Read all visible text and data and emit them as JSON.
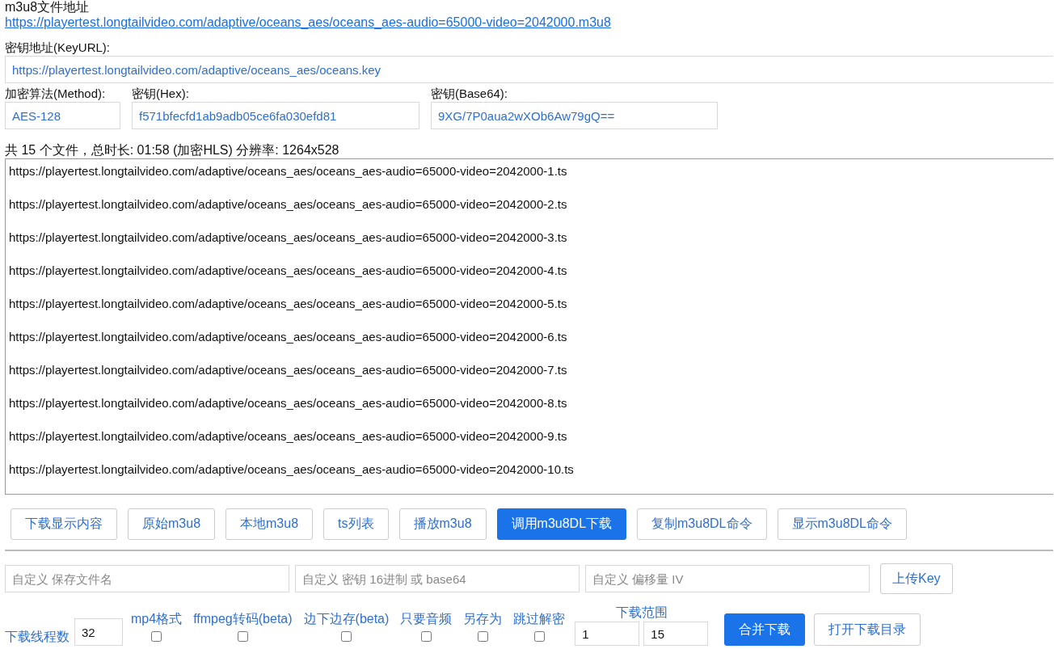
{
  "m3u8_label": "m3u8文件地址",
  "m3u8_url": "https://playertest.longtailvideo.com/adaptive/oceans_aes/oceans_aes-audio=65000-video=2042000.m3u8",
  "key_url": {
    "label": "密钥地址(KeyURL):",
    "value": "https://playertest.longtailvideo.com/adaptive/oceans_aes/oceans.key"
  },
  "key_fields": [
    {
      "label": "加密算法(Method):",
      "value": "AES-128"
    },
    {
      "label": "密钥(Hex):",
      "value": "f571bfecfd1ab9adb05ce6fa030efd81"
    },
    {
      "label": "密钥(Base64):",
      "value": "9XG/7P0aua2wXOb6Aw79gQ=="
    }
  ],
  "summary": "共 15 个文件，总时长: 01:58 (加密HLS) 分辨率: 1264x528",
  "ts_list": [
    "https://playertest.longtailvideo.com/adaptive/oceans_aes/oceans_aes-audio=65000-video=2042000-1.ts",
    "https://playertest.longtailvideo.com/adaptive/oceans_aes/oceans_aes-audio=65000-video=2042000-2.ts",
    "https://playertest.longtailvideo.com/adaptive/oceans_aes/oceans_aes-audio=65000-video=2042000-3.ts",
    "https://playertest.longtailvideo.com/adaptive/oceans_aes/oceans_aes-audio=65000-video=2042000-4.ts",
    "https://playertest.longtailvideo.com/adaptive/oceans_aes/oceans_aes-audio=65000-video=2042000-5.ts",
    "https://playertest.longtailvideo.com/adaptive/oceans_aes/oceans_aes-audio=65000-video=2042000-6.ts",
    "https://playertest.longtailvideo.com/adaptive/oceans_aes/oceans_aes-audio=65000-video=2042000-7.ts",
    "https://playertest.longtailvideo.com/adaptive/oceans_aes/oceans_aes-audio=65000-video=2042000-8.ts",
    "https://playertest.longtailvideo.com/adaptive/oceans_aes/oceans_aes-audio=65000-video=2042000-9.ts",
    "https://playertest.longtailvideo.com/adaptive/oceans_aes/oceans_aes-audio=65000-video=2042000-10.ts"
  ],
  "actions": [
    {
      "label": "下载显示内容",
      "selected": false
    },
    {
      "label": "原始m3u8",
      "selected": false
    },
    {
      "label": "本地m3u8",
      "selected": false
    },
    {
      "label": "ts列表",
      "selected": false
    },
    {
      "label": "播放m3u8",
      "selected": false
    },
    {
      "label": "调用m3u8DL下载",
      "selected": true
    },
    {
      "label": "复制m3u8DL命令",
      "selected": false
    },
    {
      "label": "显示m3u8DL命令",
      "selected": false
    }
  ],
  "custom_fields": [
    {
      "placeholder": "自定义 保存文件名"
    },
    {
      "placeholder": "自定义 密钥 16进制 或 base64"
    },
    {
      "placeholder": "自定义 偏移量 IV"
    }
  ],
  "upload_key": "上传Key",
  "threads": {
    "label": "下载线程数",
    "value": "32"
  },
  "options": [
    {
      "label": "mp4格式",
      "checked": false
    },
    {
      "label": "ffmpeg转码(beta)",
      "checked": false
    },
    {
      "label": "边下边存(beta)",
      "checked": false
    },
    {
      "label": "只要音频",
      "checked": false
    },
    {
      "label": "另存为",
      "checked": false
    },
    {
      "label": "跳过解密",
      "checked": false
    }
  ],
  "range": {
    "label": "下载范围",
    "from": "1",
    "to": "15"
  },
  "merge_button": "合并下载",
  "open_dir_button": "打开下载目录"
}
